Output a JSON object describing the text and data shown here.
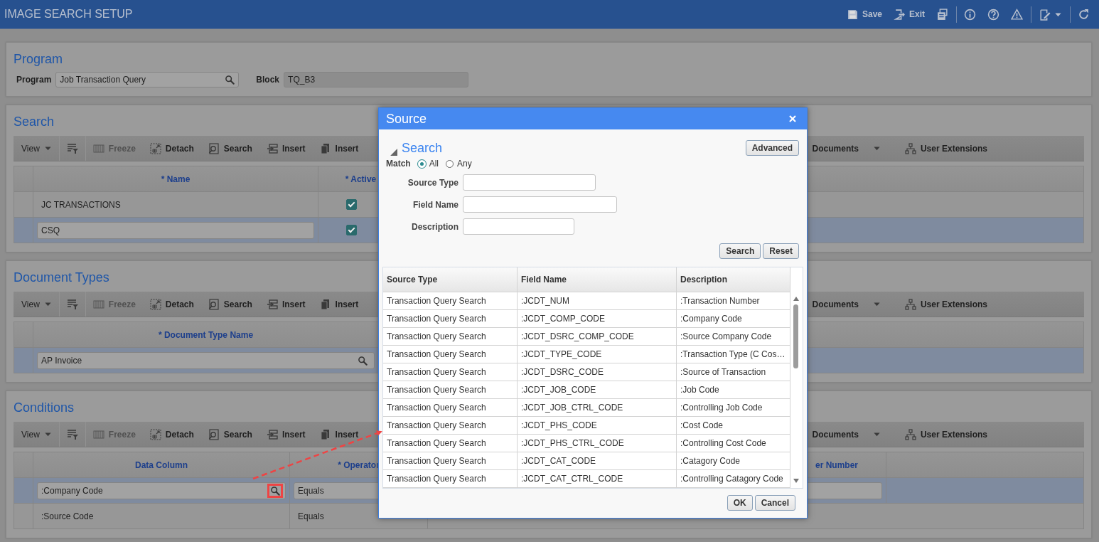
{
  "header": {
    "title": "IMAGE SEARCH SETUP",
    "actions": [
      {
        "kind": "save",
        "label": "Save",
        "separator_before": false
      },
      {
        "kind": "exit",
        "label": "Exit",
        "separator_before": false
      },
      {
        "kind": "print",
        "separator_before": false
      },
      {
        "kind": "info",
        "separator_before": true
      },
      {
        "kind": "help",
        "separator_before": false
      },
      {
        "kind": "warning",
        "separator_before": false
      },
      {
        "kind": "edit",
        "separator_before": true
      },
      {
        "kind": "refresh",
        "separator_before": true
      }
    ]
  },
  "program": {
    "title": "Program",
    "fields": [
      {
        "label": "Program",
        "value": "Job Transaction Query",
        "lookup": true,
        "disabled": false
      },
      {
        "label": "Block",
        "value": "TQ_B3",
        "lookup": false,
        "disabled": true
      }
    ]
  },
  "grids": [
    {
      "title": "Search",
      "toolbar": {
        "left": [
          {
            "kind": "view",
            "label": "View",
            "disabled": false
          },
          {
            "kind": "filter",
            "disabled": false
          },
          {
            "kind": "freeze",
            "label": "Freeze",
            "disabled": true
          },
          {
            "kind": "detach",
            "label": "Detach",
            "disabled": false
          },
          {
            "kind": "search",
            "label": "Search",
            "disabled": false
          },
          {
            "kind": "insert",
            "label": "Insert",
            "disabled": false
          },
          {
            "kind": "insert_copy",
            "label": "Insert",
            "disabled": false
          }
        ],
        "right": [
          {
            "kind": "documents",
            "label": "Documents",
            "disabled": false
          },
          {
            "kind": "extensions",
            "label": "User Extensions",
            "disabled": false
          }
        ]
      },
      "columns": [
        "* Name",
        "* Active"
      ],
      "rows": [
        {
          "selected": false,
          "cells": [
            {
              "kind": "text",
              "value": "JC TRANSACTIONS"
            },
            {
              "kind": "checkbox",
              "checked": true
            }
          ]
        },
        {
          "selected": true,
          "cells": [
            {
              "kind": "field",
              "value": "CSQ"
            },
            {
              "kind": "checkbox",
              "checked": true
            }
          ]
        }
      ]
    },
    {
      "title": "Document Types",
      "toolbar": {
        "left": [
          {
            "kind": "view",
            "label": "View",
            "disabled": false
          },
          {
            "kind": "filter",
            "disabled": false
          },
          {
            "kind": "freeze",
            "label": "Freeze",
            "disabled": true
          },
          {
            "kind": "detach",
            "label": "Detach",
            "disabled": false
          },
          {
            "kind": "search",
            "label": "Search",
            "disabled": false
          },
          {
            "kind": "insert",
            "label": "Insert",
            "disabled": false
          },
          {
            "kind": "insert_copy",
            "label": "Insert",
            "disabled": false
          }
        ],
        "right": [
          {
            "kind": "documents",
            "label": "Documents",
            "disabled": false
          },
          {
            "kind": "extensions",
            "label": "User Extensions",
            "disabled": false
          }
        ]
      },
      "columns": [
        "* Document Type Name"
      ],
      "rows": [
        {
          "selected": true,
          "cells": [
            {
              "kind": "lookup",
              "value": "AP Invoice",
              "highlighted": false
            }
          ]
        }
      ]
    },
    {
      "title": "Conditions",
      "toolbar": {
        "left": [
          {
            "kind": "view",
            "label": "View",
            "disabled": false
          },
          {
            "kind": "filter",
            "disabled": false
          },
          {
            "kind": "freeze",
            "label": "Freeze",
            "disabled": true
          },
          {
            "kind": "detach",
            "label": "Detach",
            "disabled": false
          },
          {
            "kind": "search",
            "label": "Search",
            "disabled": false
          },
          {
            "kind": "insert",
            "label": "Insert",
            "disabled": false
          },
          {
            "kind": "insert_copy",
            "label": "Insert",
            "disabled": false
          }
        ],
        "right": [
          {
            "kind": "documents",
            "label": "Documents",
            "disabled": false
          },
          {
            "kind": "extensions",
            "label": "User Extensions",
            "disabled": false
          }
        ]
      },
      "columns": [
        "Data Column",
        "* Operator",
        "er Number"
      ],
      "rows": [
        {
          "selected": true,
          "cells": [
            {
              "kind": "lookup",
              "value": ":Company Code",
              "highlighted": true
            },
            {
              "kind": "field",
              "value": "Equals"
            },
            {
              "kind": "field"
            }
          ]
        },
        {
          "selected": false,
          "cells": [
            {
              "kind": "text",
              "value": ":Source Code"
            },
            {
              "kind": "text",
              "value": "Equals"
            }
          ]
        }
      ]
    }
  ],
  "dialog": {
    "title": "Source",
    "search": {
      "title": "Search",
      "expanded": true,
      "advanced_button": "Advanced",
      "match": {
        "label": "Match",
        "options": [
          {
            "label": "All",
            "selected": true
          },
          {
            "label": "Any",
            "selected": false
          }
        ]
      },
      "fields": [
        {
          "label": "Source Type"
        },
        {
          "label": "Field Name"
        },
        {
          "label": "Description"
        }
      ],
      "buttons": [
        "Search",
        "Reset"
      ]
    },
    "table": {
      "columns": [
        "Source Type",
        "Field Name",
        "Description"
      ],
      "rows": [
        [
          "Transaction Query Search",
          ":JCDT_NUM",
          ":Transaction Number"
        ],
        [
          "Transaction Query Search",
          ":JCDT_COMP_CODE",
          ":Company Code"
        ],
        [
          "Transaction Query Search",
          ":JCDT_DSRC_COMP_CODE",
          ":Source Company Code"
        ],
        [
          "Transaction Query Search",
          ":JCDT_TYPE_CODE",
          ":Transaction Type (C Cos…"
        ],
        [
          "Transaction Query Search",
          ":JCDT_DSRC_CODE",
          ":Source of Transaction"
        ],
        [
          "Transaction Query Search",
          ":JCDT_JOB_CODE",
          ":Job Code"
        ],
        [
          "Transaction Query Search",
          ":JCDT_JOB_CTRL_CODE",
          ":Controlling Job Code"
        ],
        [
          "Transaction Query Search",
          ":JCDT_PHS_CODE",
          ":Cost Code"
        ],
        [
          "Transaction Query Search",
          ":JCDT_PHS_CTRL_CODE",
          ":Controlling Cost Code"
        ],
        [
          "Transaction Query Search",
          ":JCDT_CAT_CODE",
          ":Catagory Code"
        ],
        [
          "Transaction Query Search",
          ":JCDT_CAT_CTRL_CODE",
          ":Controlling Catagory Code"
        ]
      ]
    },
    "buttons": [
      "OK",
      "Cancel"
    ]
  }
}
